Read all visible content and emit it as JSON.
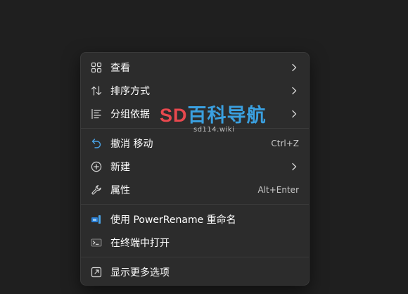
{
  "menu": {
    "items": [
      {
        "id": "view",
        "label": "查看",
        "icon": "grid-icon",
        "submenu": true
      },
      {
        "id": "sort",
        "label": "排序方式",
        "icon": "sort-arrows-icon",
        "submenu": true
      },
      {
        "id": "group",
        "label": "分组依据",
        "icon": "group-list-icon",
        "submenu": true
      },
      {
        "id": "undo",
        "label": "撤消 移动",
        "icon": "undo-icon",
        "shortcut": "Ctrl+Z"
      },
      {
        "id": "new",
        "label": "新建",
        "icon": "plus-circle-icon",
        "submenu": true
      },
      {
        "id": "properties",
        "label": "属性",
        "icon": "wrench-icon",
        "shortcut": "Alt+Enter"
      },
      {
        "id": "powerrename",
        "label": "使用 PowerRename 重命名",
        "icon": "powerrename-icon"
      },
      {
        "id": "terminal",
        "label": "在终端中打开",
        "icon": "terminal-icon"
      },
      {
        "id": "more",
        "label": "显示更多选项",
        "icon": "expand-icon"
      }
    ]
  },
  "watermark": {
    "brand_sd": "SD",
    "brand_cn": "百科导航",
    "url": "sd114.wiki"
  },
  "colors": {
    "background": "#1f1f1f",
    "menu_bg": "#2c2c2c",
    "text": "#ffffff",
    "shortcut_text": "#c8c8c8",
    "icon": "#d6d6d6",
    "accent_blue": "#4aa3e6",
    "watermark_red": "#e8484e",
    "watermark_blue": "#3aa0e0"
  }
}
